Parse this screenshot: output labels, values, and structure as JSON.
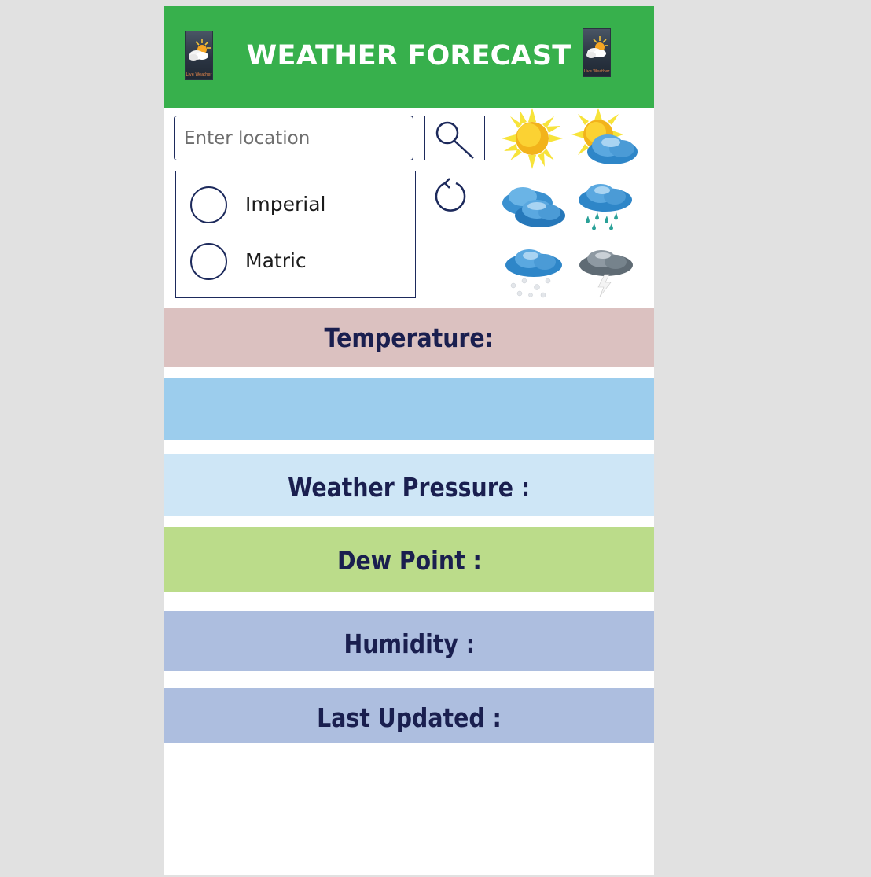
{
  "header": {
    "title": "WEATHER FORECAST",
    "logo_text": "Live Weather"
  },
  "search": {
    "placeholder": "Enter location",
    "value": ""
  },
  "units": {
    "options": [
      {
        "label": "Imperial",
        "selected": false
      },
      {
        "label": "Matric",
        "selected": false
      }
    ]
  },
  "weather_icons": [
    "sunny-icon",
    "partly-cloudy-icon",
    "cloudy-icon",
    "rain-icon",
    "snow-icon",
    "thunderstorm-icon"
  ],
  "fields": {
    "temperature": "Temperature:",
    "pressure": "Weather Pressure :",
    "dew_point": "Dew Point :",
    "humidity": "Humidity :",
    "last_updated": "Last Updated :"
  },
  "colors": {
    "header": "#37b04c",
    "temperature_band": "#dbc1c0",
    "value_band": "#9ccded",
    "pressure_band": "#cee6f6",
    "dew_point_band": "#bbdc8a",
    "humidity_band": "#adbedf",
    "last_updated_band": "#adbedf",
    "label_text": "#1a1f4f"
  }
}
